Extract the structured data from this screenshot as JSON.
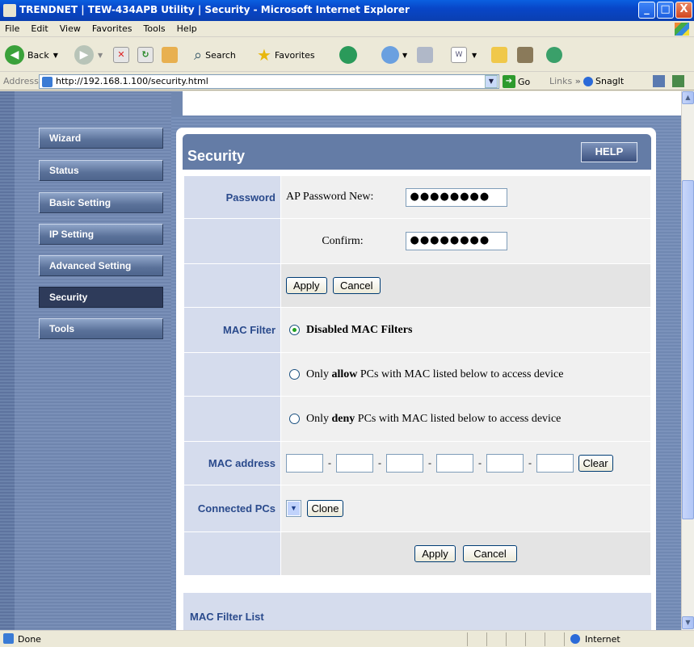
{
  "window": {
    "title": "TRENDNET | TEW-434APB Utility | Security - Microsoft Internet Explorer",
    "min": "_",
    "max": "□",
    "close": "X"
  },
  "menu": [
    "File",
    "Edit",
    "View",
    "Favorites",
    "Tools",
    "Help"
  ],
  "toolbar": {
    "back": "Back",
    "search": "Search",
    "favorites": "Favorites"
  },
  "addressbar": {
    "label": "Address",
    "url": "http://192.168.1.100/security.html",
    "go": "Go",
    "links": "Links",
    "snagit": "SnagIt"
  },
  "sidebar": {
    "items": [
      {
        "label": "Wizard",
        "active": false
      },
      {
        "label": "Status",
        "active": false
      },
      {
        "label": "Basic Setting",
        "active": false
      },
      {
        "label": "IP Setting",
        "active": false
      },
      {
        "label": "Advanced Setting",
        "active": false
      },
      {
        "label": "Security",
        "active": true
      },
      {
        "label": "Tools",
        "active": false
      }
    ]
  },
  "panel": {
    "title": "Security",
    "help": "HELP"
  },
  "password": {
    "label": "Password",
    "new_label": "AP Password New:",
    "new_value": "●●●●●●●●",
    "confirm_label": "Confirm:",
    "confirm_value": "●●●●●●●●",
    "apply": "Apply",
    "cancel": "Cancel"
  },
  "mac_filter": {
    "label": "MAC Filter",
    "options": [
      {
        "prefix": "Disabled MAC Filters",
        "bold": "",
        "suffix": "",
        "selected": true
      },
      {
        "prefix": "Only ",
        "bold": "allow",
        "suffix": " PCs with MAC listed below to access device",
        "selected": false
      },
      {
        "prefix": "Only ",
        "bold": "deny",
        "suffix": " PCs with MAC listed below to access device",
        "selected": false
      }
    ]
  },
  "mac_address": {
    "label": "MAC address",
    "separator": "-",
    "clear": "Clear"
  },
  "connected_pcs": {
    "label": "Connected PCs",
    "clone": "Clone"
  },
  "bottom_buttons": {
    "apply": "Apply",
    "cancel": "Cancel"
  },
  "mac_filter_list": {
    "title": "MAC Filter List"
  },
  "status": {
    "left": "Done",
    "zone": "Internet"
  },
  "colors": {
    "titlebar": "#0846c8",
    "panel_header": "#647ca6",
    "label_cell": "#d5dced",
    "label_text": "#2a4a8c"
  }
}
